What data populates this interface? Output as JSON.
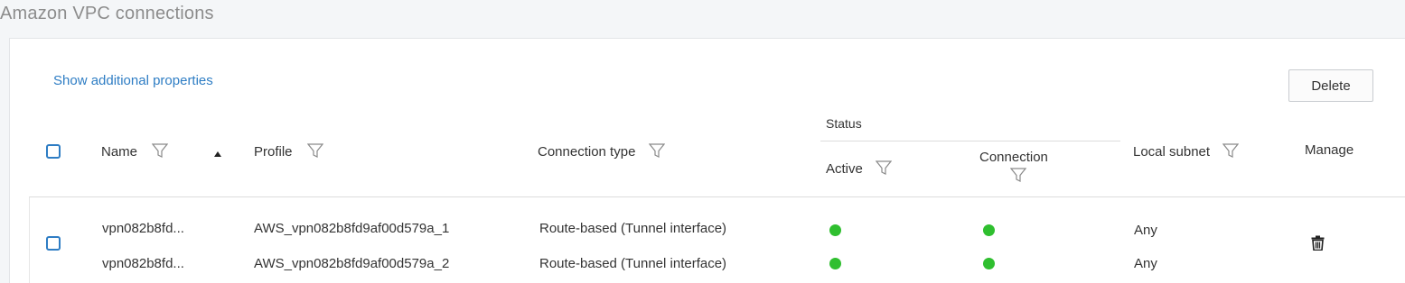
{
  "page": {
    "title": "Amazon VPC connections"
  },
  "toolbar": {
    "show_props_label": "Show additional properties",
    "delete_label": "Delete"
  },
  "table": {
    "columns": {
      "name": "Name",
      "profile": "Profile",
      "connection_type": "Connection type",
      "status_group": "Status",
      "active": "Active",
      "connection": "Connection",
      "local_subnet": "Local subnet",
      "manage": "Manage"
    },
    "rows": [
      {
        "name": "vpn082b8fd...",
        "profile": "AWS_vpn082b8fd9af00d579a_1",
        "connection_type": "Route-based (Tunnel interface)",
        "active_status": "green",
        "connection_status": "green",
        "local_subnet": "Any"
      },
      {
        "name": "vpn082b8fd...",
        "profile": "AWS_vpn082b8fd9af00d579a_2",
        "connection_type": "Route-based (Tunnel interface)",
        "active_status": "green",
        "connection_status": "green",
        "local_subnet": "Any"
      }
    ]
  },
  "colors": {
    "accent": "#2e7dc4",
    "status_ok": "#2fbf2f"
  },
  "icons": {
    "filter": "filter-icon",
    "sort": "sort-ascending-icon",
    "delete": "trash-icon"
  }
}
